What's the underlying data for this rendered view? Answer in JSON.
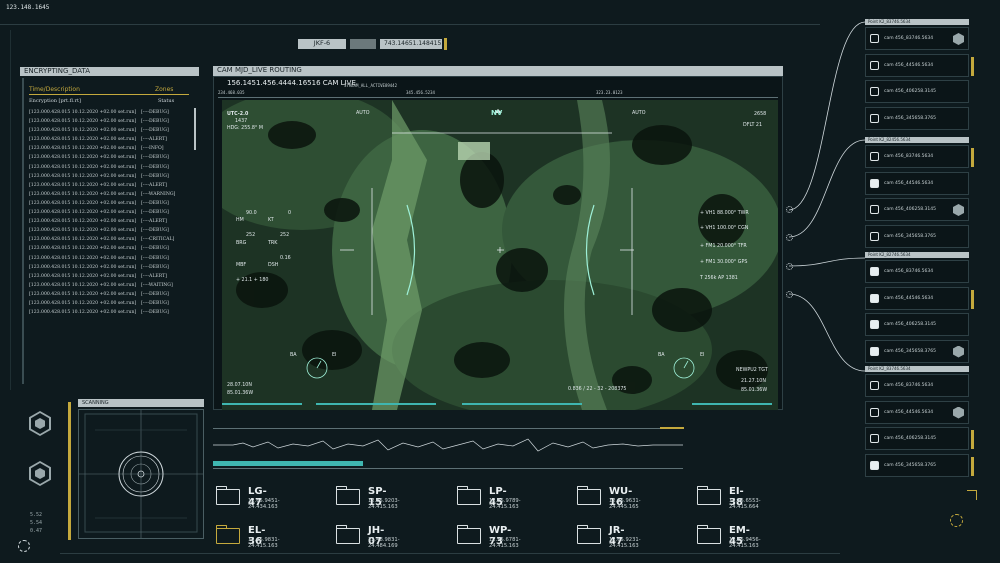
{
  "corner_id": "123.148.1645",
  "top_bar": {
    "tag_left": "JKF-6",
    "tag_right": "743.14651.148415"
  },
  "encrypt_panel": {
    "title": "ENCRYPTING_DATA",
    "col_desc": "Time/Description",
    "col_zones": "Zones",
    "sub_desc": "Encryption [prt.fl.rt]",
    "sub_status": "Status",
    "rows": [
      [
        "[123.000.428.015 10.12.2020 +02.00 set.run]",
        "[----DEBUG]"
      ],
      [
        "[123.000.428.015 10.12.2020 +02.00 set.run]",
        "[----DEBUG]"
      ],
      [
        "[123.000.428.015 10.12.2020 +02.00 set.run]",
        "[----DEBUG]"
      ],
      [
        "[123.000.428.015 10.12.2020 +02.00 set.run]",
        "[----ALERT]"
      ],
      [
        "[123.000.428.015 10.12.2020 +02.00 set.run]",
        "[----INFO]"
      ],
      [
        "[123.000.428.015 10.12.2020 +02.00 set.run]",
        "[----DEBUG]"
      ],
      [
        "[123.000.428.015 10.12.2020 +02.00 set.run]",
        "[----DEBUG]"
      ],
      [
        "[123.000.428.015 10.12.2020 +02.00 set.run]",
        "[----DEBUG]"
      ],
      [
        "[123.000.428.015 10.12.2020 +02.00 set.run]",
        "[----ALERT]"
      ],
      [
        "[123.000.428.015 10.12.2020 +02.00 set.run]",
        "[----WARNING]"
      ],
      [
        "[123.000.428.015 10.12.2020 +02.00 set.run]",
        "[----DEBUG]"
      ],
      [
        "[123.000.428.015 10.12.2020 +02.00 set.run]",
        "[----DEBUG]"
      ],
      [
        "[123.000.428.015 10.12.2020 +02.00 set.run]",
        "[----ALERT]"
      ],
      [
        "[123.000.428.015 10.12.2020 +02.00 set.run]",
        "[----DEBUG]"
      ],
      [
        "[123.000.428.015 10.12.2020 +02.00 set.run]",
        "[----CRITICAL]"
      ],
      [
        "[123.000.428.015 10.12.2020 +02.00 set.run]",
        "[----DEBUG]"
      ],
      [
        "[123.000.428.015 10.12.2020 +02.00 set.run]",
        "[----DEBUG]"
      ],
      [
        "[123.000.428.015 10.12.2020 +02.00 set.run]",
        "[----DEBUG]"
      ],
      [
        "[123.000.428.015 10.12.2020 +02.00 set.run]",
        "[----ALERT]"
      ],
      [
        "[123.000.428.015 10.12.2020 +02.00 set.run]",
        "[----WAITING]"
      ],
      [
        "[123.000.428.015 10.12.2020 +02.00 set.run]",
        "[----DEBUG]"
      ],
      [
        "[123.000.428.015 10.12.2020 +02.00 set.run]",
        "[----DEBUG]"
      ],
      [
        "[123.000.428.015 10.12.2020 +02.00 set.run]",
        "[----DEBUG]"
      ]
    ]
  },
  "scanning": {
    "title": "SCANNING"
  },
  "camera": {
    "title": "CAM MJD_LIVE ROUTING",
    "subtitle": "156.1451.456.4444.16516 CAM LIVE",
    "stream_tag": "STREAM_ALL_ACTIVE89442",
    "ruler": [
      "234.468.035",
      "345.456.5234",
      "323.23.0123"
    ],
    "mode": "NV",
    "auto_left": "AUTO",
    "auto_right": "AUTO",
    "top_left": [
      "UTC-2.0",
      "1437",
      "HDG: 255.8° M"
    ],
    "top_right": [
      "2658",
      "DFLT 21"
    ],
    "left_grid": [
      [
        "90.0",
        "0"
      ],
      [
        "HM",
        "KT"
      ],
      [
        "252",
        "252"
      ],
      [
        "BRG",
        "TRK"
      ],
      [
        "",
        "0.16"
      ],
      [
        "MBF",
        "DSH"
      ]
    ],
    "left_small": "+ 21.1  + 180",
    "right_list": [
      "+ VH1  88.000°  TWR",
      "+ VH1  100.00°  CGN",
      "+ FM1  20.000°  TFR",
      "+ FM1  30.000°  GPS",
      "T  256k  AP  1381"
    ],
    "bottom_left": [
      "28.07.10N",
      "85.01.36W"
    ],
    "bottom_right": [
      "NEWPU2 TGT",
      "21.27.10N",
      "85.01.36W"
    ],
    "bottom_mid": "0.836 / 22 - 32 - 208375",
    "ba_l": "BA",
    "ba_r": "EI"
  },
  "targets": [
    {
      "name": "LG-47",
      "coord": "12.65.9451-24.434.163",
      "gold": false
    },
    {
      "name": "SP-15",
      "coord": "12.65.9203-24.415.163",
      "gold": false
    },
    {
      "name": "LP-45",
      "coord": "12.65.9789-24.415.163",
      "gold": false
    },
    {
      "name": "WU-16",
      "coord": "12.65.9631-24.445.165",
      "gold": false
    },
    {
      "name": "EI-38",
      "coord": "12.65.6553-24.415.664",
      "gold": false
    },
    {
      "name": "EL-36",
      "coord": "12.65.9831-24.415.163",
      "gold": true
    },
    {
      "name": "JH-07",
      "coord": "12.48.9831-24.484.169",
      "gold": false
    },
    {
      "name": "WP-73",
      "coord": "12.55.6781-24.415.163",
      "gold": false
    },
    {
      "name": "JR-47",
      "coord": "12.65.9231-24.415.163",
      "gold": false
    },
    {
      "name": "EM-45",
      "coord": "12.65.9456-24.415.163",
      "gold": false
    }
  ],
  "cam_groups": [
    {
      "header": "Point K2_83746.5634",
      "items": [
        {
          "label": "cam 456_83746.5634",
          "checked": false,
          "hex": true,
          "mark": false
        },
        {
          "label": "cam 456_44546.5634",
          "checked": false,
          "hex": false,
          "mark": true
        },
        {
          "label": "cam 456_406258.3145",
          "checked": false,
          "hex": false,
          "mark": false
        },
        {
          "label": "cam 456_345658.3765",
          "checked": false,
          "hex": false,
          "mark": false
        }
      ]
    },
    {
      "header": "Point K2_82456.5634",
      "items": [
        {
          "label": "cam 456_83746.5634",
          "checked": false,
          "hex": false,
          "mark": true
        },
        {
          "label": "cam 456_44546.5634",
          "checked": true,
          "hex": false,
          "mark": false
        },
        {
          "label": "cam 456_406258.3145",
          "checked": false,
          "hex": true,
          "mark": false
        },
        {
          "label": "cam 456_345658.3765",
          "checked": false,
          "hex": false,
          "mark": false
        }
      ]
    },
    {
      "header": "Point K2_82746.5634",
      "items": [
        {
          "label": "cam 456_83746.5634",
          "checked": true,
          "hex": false,
          "mark": false
        },
        {
          "label": "cam 456_44546.5634",
          "checked": true,
          "hex": false,
          "mark": true
        },
        {
          "label": "cam 456_406258.3145",
          "checked": true,
          "hex": false,
          "mark": false
        },
        {
          "label": "cam 456_345658.3765",
          "checked": true,
          "hex": true,
          "mark": false
        }
      ]
    },
    {
      "header": "Point K2_83746.5634",
      "items": [
        {
          "label": "cam 456_83746.5634",
          "checked": false,
          "hex": false,
          "mark": false
        },
        {
          "label": "cam 456_44546.5634",
          "checked": false,
          "hex": true,
          "mark": false
        },
        {
          "label": "cam 456_406258.3145",
          "checked": false,
          "hex": false,
          "mark": true
        },
        {
          "label": "cam 456_345658.3765",
          "checked": true,
          "hex": false,
          "mark": true
        }
      ]
    }
  ],
  "bottom_left_readout": [
    "5.52",
    "5.54",
    "0.47"
  ],
  "colors": {
    "accent_gold": "#c4a93d",
    "accent_teal": "#3fb6b0",
    "panel_bg": "#0b1518"
  }
}
